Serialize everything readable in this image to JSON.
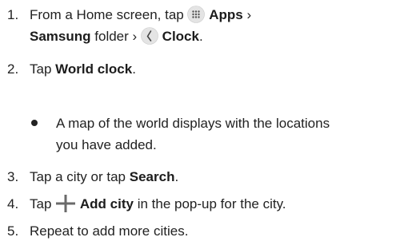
{
  "steps": [
    {
      "num": "1.",
      "pre": "From a Home screen, tap",
      "apps_label": "Apps",
      "sep1": "›",
      "samsung_label": "Samsung",
      "folder_text": "folder",
      "sep2": "›",
      "clock_label": "Clock",
      "end": "."
    },
    {
      "num": "2.",
      "pre": "Tap",
      "bold": "World clock",
      "end": "."
    },
    {
      "num": "3.",
      "pre": "Tap a city or tap",
      "bold": "Search",
      "end": "."
    },
    {
      "num": "4.",
      "pre": "Tap",
      "bold": "Add city",
      "post": "in the pop-up for the city."
    },
    {
      "num": "5.",
      "text": "Repeat to add more cities."
    }
  ],
  "bullet": {
    "line1": "A map of the world displays with the locations",
    "line2": "you have added."
  },
  "icons": {
    "apps": "apps-grid-icon",
    "clock": "clock-app-icon",
    "add": "plus-icon"
  },
  "colors": {
    "text": "#222222",
    "icon_bg": "#e4e4e4",
    "plus": "#6a6a6a"
  }
}
